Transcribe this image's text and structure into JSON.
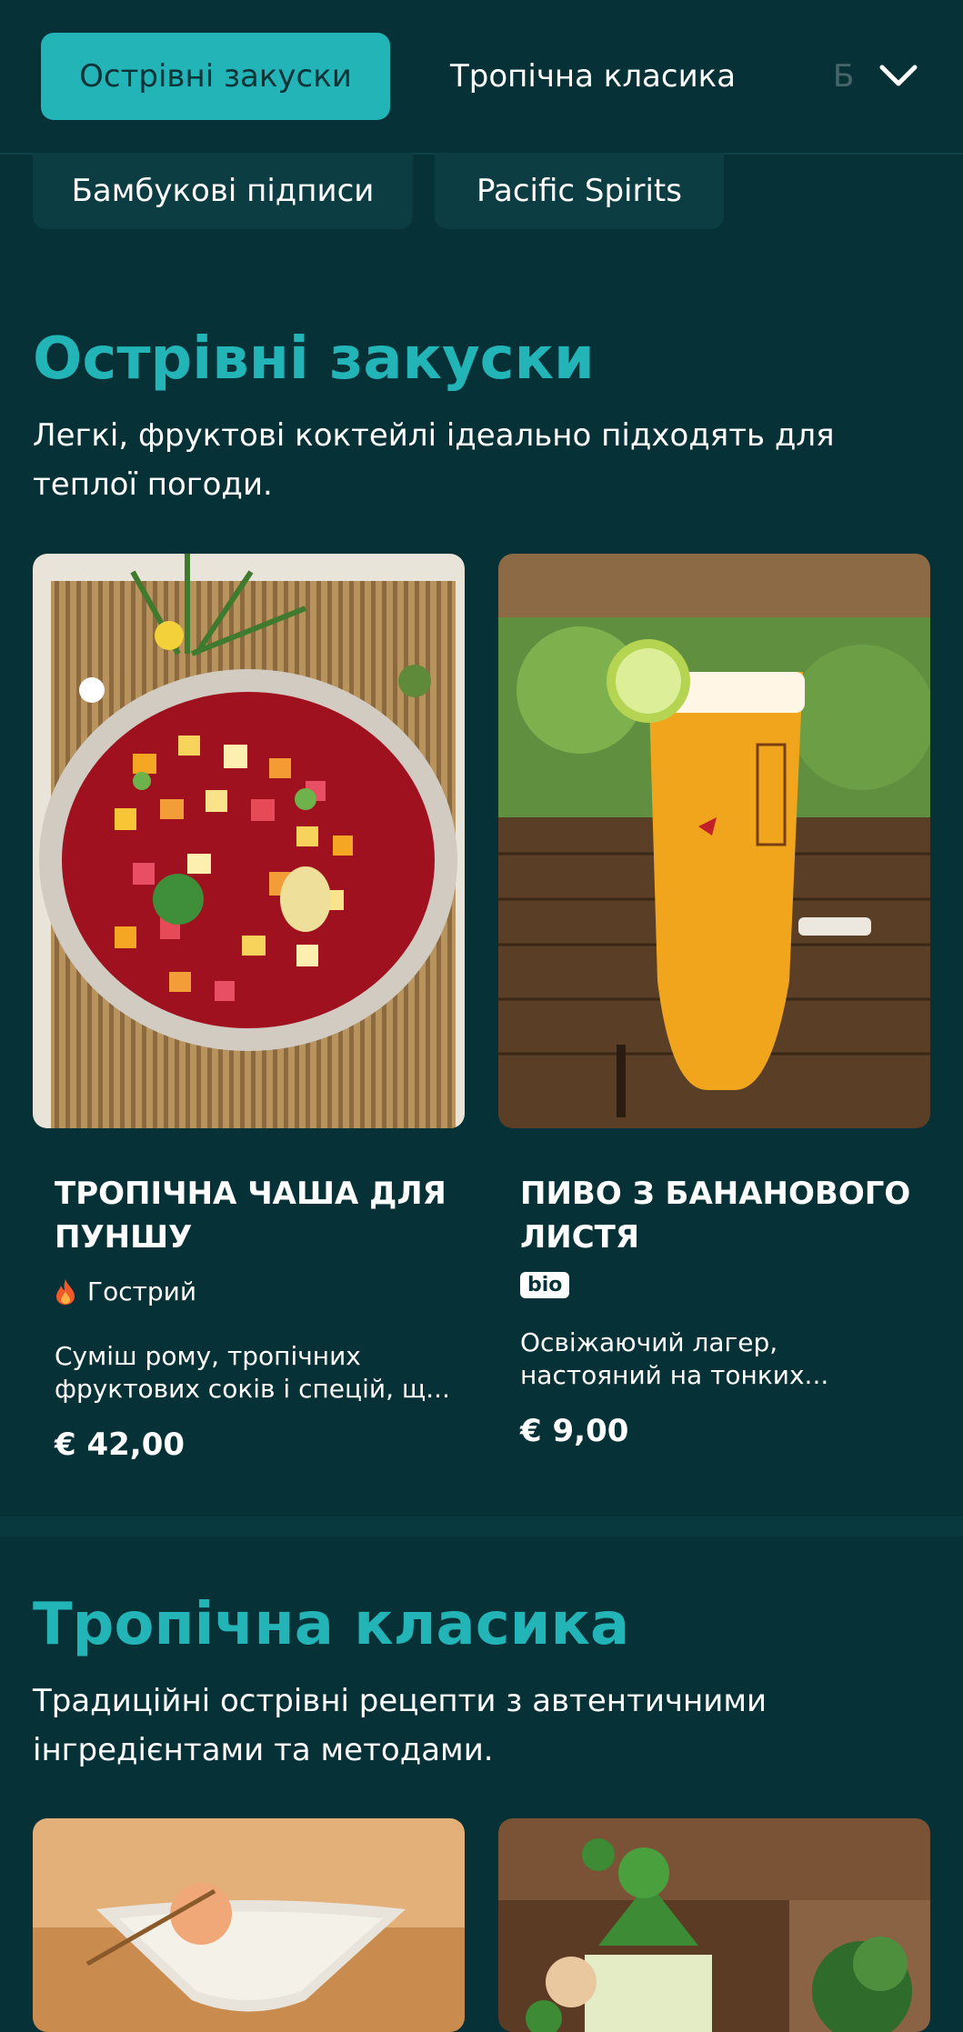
{
  "nav": {
    "tabs": [
      {
        "label": "Острівні закуски",
        "active": true
      },
      {
        "label": "Тропічна класика",
        "active": false
      },
      {
        "label": "Б",
        "active": false
      }
    ],
    "chips": [
      {
        "label": "Бамбукові підписи"
      },
      {
        "label": "Pacific Spirits"
      }
    ],
    "expand_icon": "chevron-down-icon"
  },
  "sections": [
    {
      "title": "Острівні закуски",
      "description": "Легкі, фруктові коктейлі ідеально підходять для теплої погоди.",
      "items": [
        {
          "image_subject": "tropical punch bowl with fruit",
          "name": "ТРОПІЧНА ЧАША ДЛЯ ПУНШУ",
          "tag": "Гострий",
          "tag_icon": "flame-icon",
          "description": "Суміш рому, тропічних фруктових соків і спецій, щ...",
          "price": "€ 42,00"
        },
        {
          "image_subject": "glass of beer with lime",
          "name": "ПИВО З БАНАНОВОГО ЛИСТЯ",
          "tag": "bio",
          "tag_icon": "bio-badge",
          "description": "Освіжаючий лагер, настояний на тонких...",
          "price": "€ 9,00"
        }
      ]
    },
    {
      "title": "Тропічна класика",
      "description": "Традиційні острівні рецепти з автентичними інгредієнтами та методами.",
      "items": [
        {
          "image_subject": "martini cocktail with lychee"
        },
        {
          "image_subject": "mojito with mint"
        }
      ]
    }
  ],
  "colors": {
    "background": "#063237",
    "accent": "#22b4b7",
    "card_bg": "#0b3d42"
  }
}
